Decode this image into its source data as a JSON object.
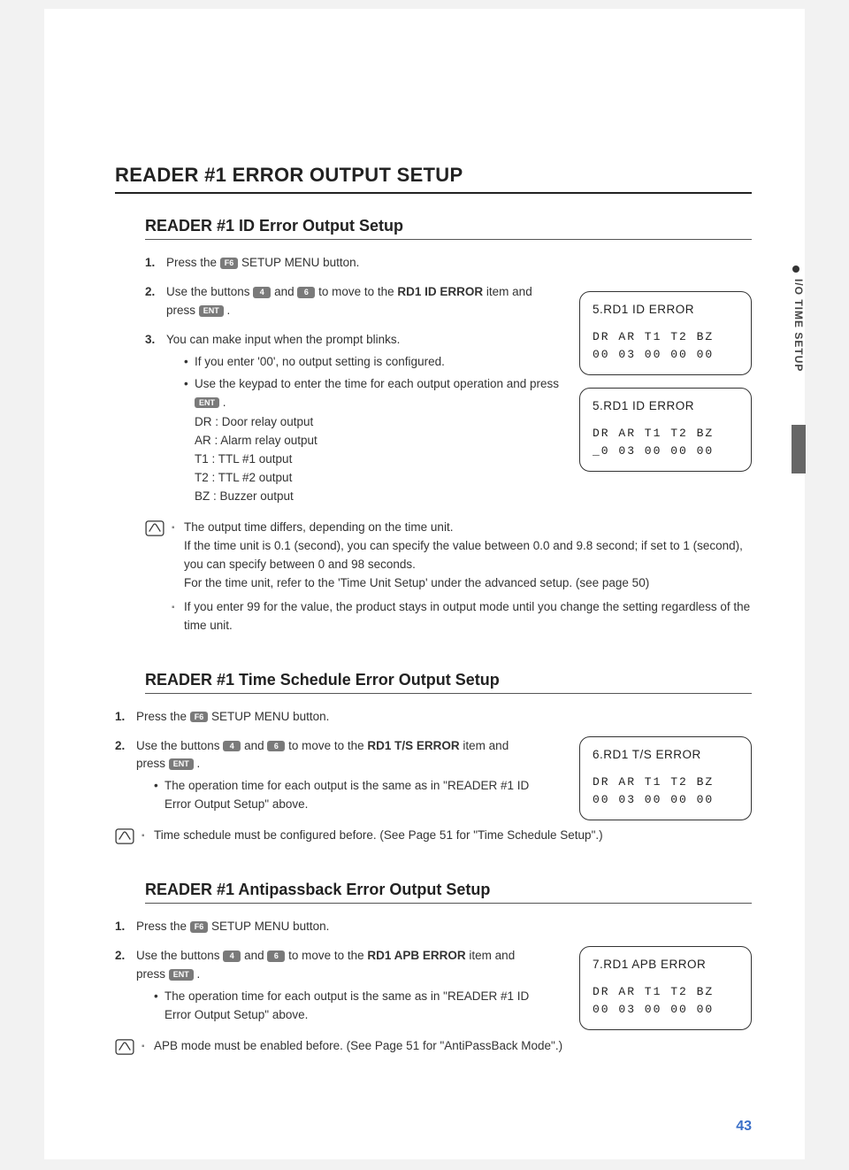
{
  "sideTab": "I/O TIME SETUP",
  "pageNumber": "43",
  "mainTitle": "READER #1 ERROR OUTPUT SETUP",
  "keys": {
    "f6": "F6",
    "k4": "4",
    "k6": "6",
    "ent": "ENT"
  },
  "sec1": {
    "title": "READER #1 ID Error Output Setup",
    "step1a": "Press the ",
    "step1b": " SETUP MENU button.",
    "step2a": "Use the buttons ",
    "step2b": " and ",
    "step2c": " to move to the ",
    "step2bold": "RD1 ID ERROR",
    "step2d": " item and press ",
    "step2e": " .",
    "step3": "You can make input when the prompt blinks.",
    "step3sub1": "If you enter '00', no output setting is configured.",
    "step3sub2a": "Use the keypad to enter the time for each output operation and press ",
    "step3sub2b": " .",
    "defs": {
      "dr": "DR : Door relay output",
      "ar": "AR : Alarm relay output",
      "t1": "T1 : TTL #1 output",
      "t2": "T2 : TTL #2 output",
      "bz": "BZ : Buzzer output"
    },
    "disp1": {
      "t": "5.RD1 ID ERROR",
      "l1": "DR AR T1 T2 BZ",
      "l2": "00 03 00 00 00"
    },
    "disp2": {
      "t": "5.RD1 ID ERROR",
      "l1": "DR AR T1 T2 BZ",
      "l2": "_0 03 00 00 00"
    },
    "note1": "The output time differs, depending on the time unit.",
    "note1b": "If the time unit is 0.1 (second), you can specify the value between 0.0 and 9.8 second; if set to 1 (second), you can specify between 0 and 98 seconds.",
    "note1c": "For the time unit, refer to the 'Time Unit Setup' under the advanced setup. (see page 50)",
    "note2": "If you enter 99 for the value, the product stays in output mode until you change the setting regardless of the time unit."
  },
  "sec2": {
    "title": "READER #1 Time Schedule Error Output Setup",
    "step1a": "Press the ",
    "step1b": " SETUP MENU button.",
    "step2a": "Use the buttons ",
    "step2b": " and ",
    "step2c": " to move to the ",
    "step2bold": "RD1 T/S ERROR",
    "step2d": " item and press ",
    "step2e": " .",
    "step2sub": "The operation time for each output is the same as in \"READER #1 ID Error Output Setup\" above.",
    "disp": {
      "t": "6.RD1 T/S ERROR",
      "l1": "DR AR T1 T2 BZ",
      "l2": "00 03 00 00 00"
    },
    "note": "Time schedule must be configured before. (See Page 51 for \"Time Schedule Setup\".)"
  },
  "sec3": {
    "title": "READER #1 Antipassback Error Output Setup",
    "step1a": "Press the ",
    "step1b": " SETUP MENU button.",
    "step2a": "Use the buttons ",
    "step2b": " and ",
    "step2c": " to move to the ",
    "step2bold": "RD1 APB ERROR",
    "step2d": " item and press ",
    "step2e": " .",
    "step2sub": "The operation time for each output is the same as in \"READER #1 ID Error Output Setup\" above.",
    "disp": {
      "t": "7.RD1 APB ERROR",
      "l1": "DR AR T1 T2 BZ",
      "l2": "00 03 00 00 00"
    },
    "note": "APB mode must be enabled before. (See Page 51 for \"AntiPassBack Mode\".)"
  }
}
